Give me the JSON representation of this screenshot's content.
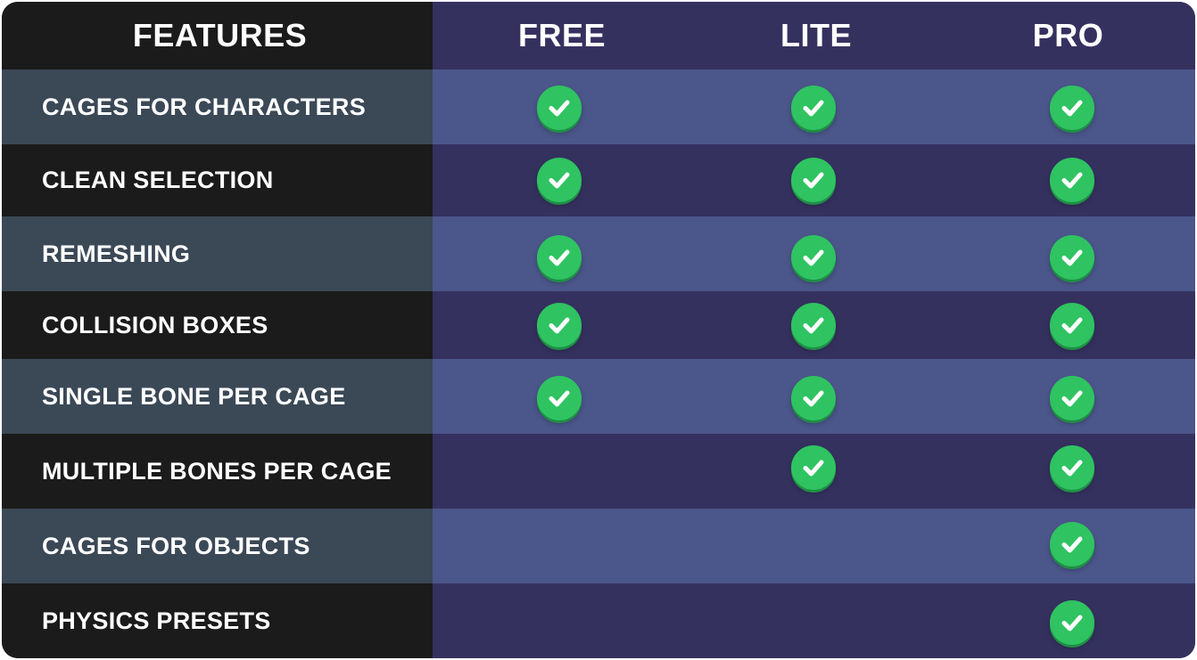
{
  "header": {
    "features_label": "FEATURES",
    "plans": [
      "FREE",
      "LITE",
      "PRO"
    ]
  },
  "rows": [
    {
      "label": "CAGES FOR CHARACTERS",
      "free": true,
      "lite": true,
      "pro": true
    },
    {
      "label": "CLEAN SELECTION",
      "free": true,
      "lite": true,
      "pro": true
    },
    {
      "label": "REMESHING",
      "free": true,
      "lite": true,
      "pro": true
    },
    {
      "label": "COLLISION BOXES",
      "free": true,
      "lite": true,
      "pro": true
    },
    {
      "label": "SINGLE BONE PER CAGE",
      "free": true,
      "lite": true,
      "pro": true
    },
    {
      "label": "MULTIPLE BONES PER CAGE",
      "free": false,
      "lite": true,
      "pro": true
    },
    {
      "label": "CAGES FOR OBJECTS",
      "free": false,
      "lite": false,
      "pro": true
    },
    {
      "label": "PHYSICS PRESETS",
      "free": false,
      "lite": false,
      "pro": true
    }
  ],
  "colors": {
    "feature_header_bg": "#1b1b1b",
    "plan_header_bg": "#35315f",
    "feature_row_light": "#3b4856",
    "feature_row_dark": "#1b1b1b",
    "plan_row_light": "#4b568a",
    "plan_row_dark": "#35315f",
    "check_green": "#2fc361"
  },
  "icons": {
    "check": "check-circle-icon"
  }
}
